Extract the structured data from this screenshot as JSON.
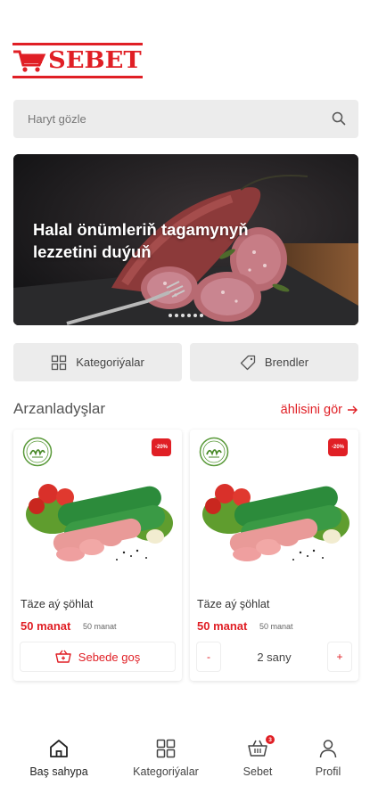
{
  "brand": {
    "name": "SEBET",
    "color": "#e01f25"
  },
  "search": {
    "placeholder": "Haryt gözle",
    "icon": "search-icon"
  },
  "banner": {
    "title": "Halal önümleriň tagamynyň lezzetini duýuň",
    "slides": 6,
    "active_slide": 0
  },
  "quick_links": [
    {
      "label": "Kategoriýalar",
      "icon": "grid-icon"
    },
    {
      "label": "Brendler",
      "icon": "tag-icon"
    }
  ],
  "section": {
    "title": "Arzanladyşlar",
    "see_all": "ählisini gör"
  },
  "products": [
    {
      "name": "Täze aý şöhlat",
      "price": "50 manat",
      "old_price": "50 manat",
      "discount": "-20%",
      "badge": "halal-badge",
      "action": "Sebede goş"
    },
    {
      "name": "Täze aý şöhlat",
      "price": "50 manat",
      "old_price": "50 manat",
      "discount": "-20%",
      "badge": "halal-badge",
      "stepper": {
        "minus": "-",
        "quantity": "2 sany",
        "plus": "+"
      }
    }
  ],
  "nav": [
    {
      "label": "Baş sahypa",
      "icon": "home-icon",
      "active": true
    },
    {
      "label": "Kategoriýalar",
      "icon": "grid-icon",
      "active": false
    },
    {
      "label": "Sebet",
      "icon": "basket-icon",
      "active": false,
      "badge": "3"
    },
    {
      "label": "Profil",
      "icon": "user-icon",
      "active": false
    }
  ]
}
